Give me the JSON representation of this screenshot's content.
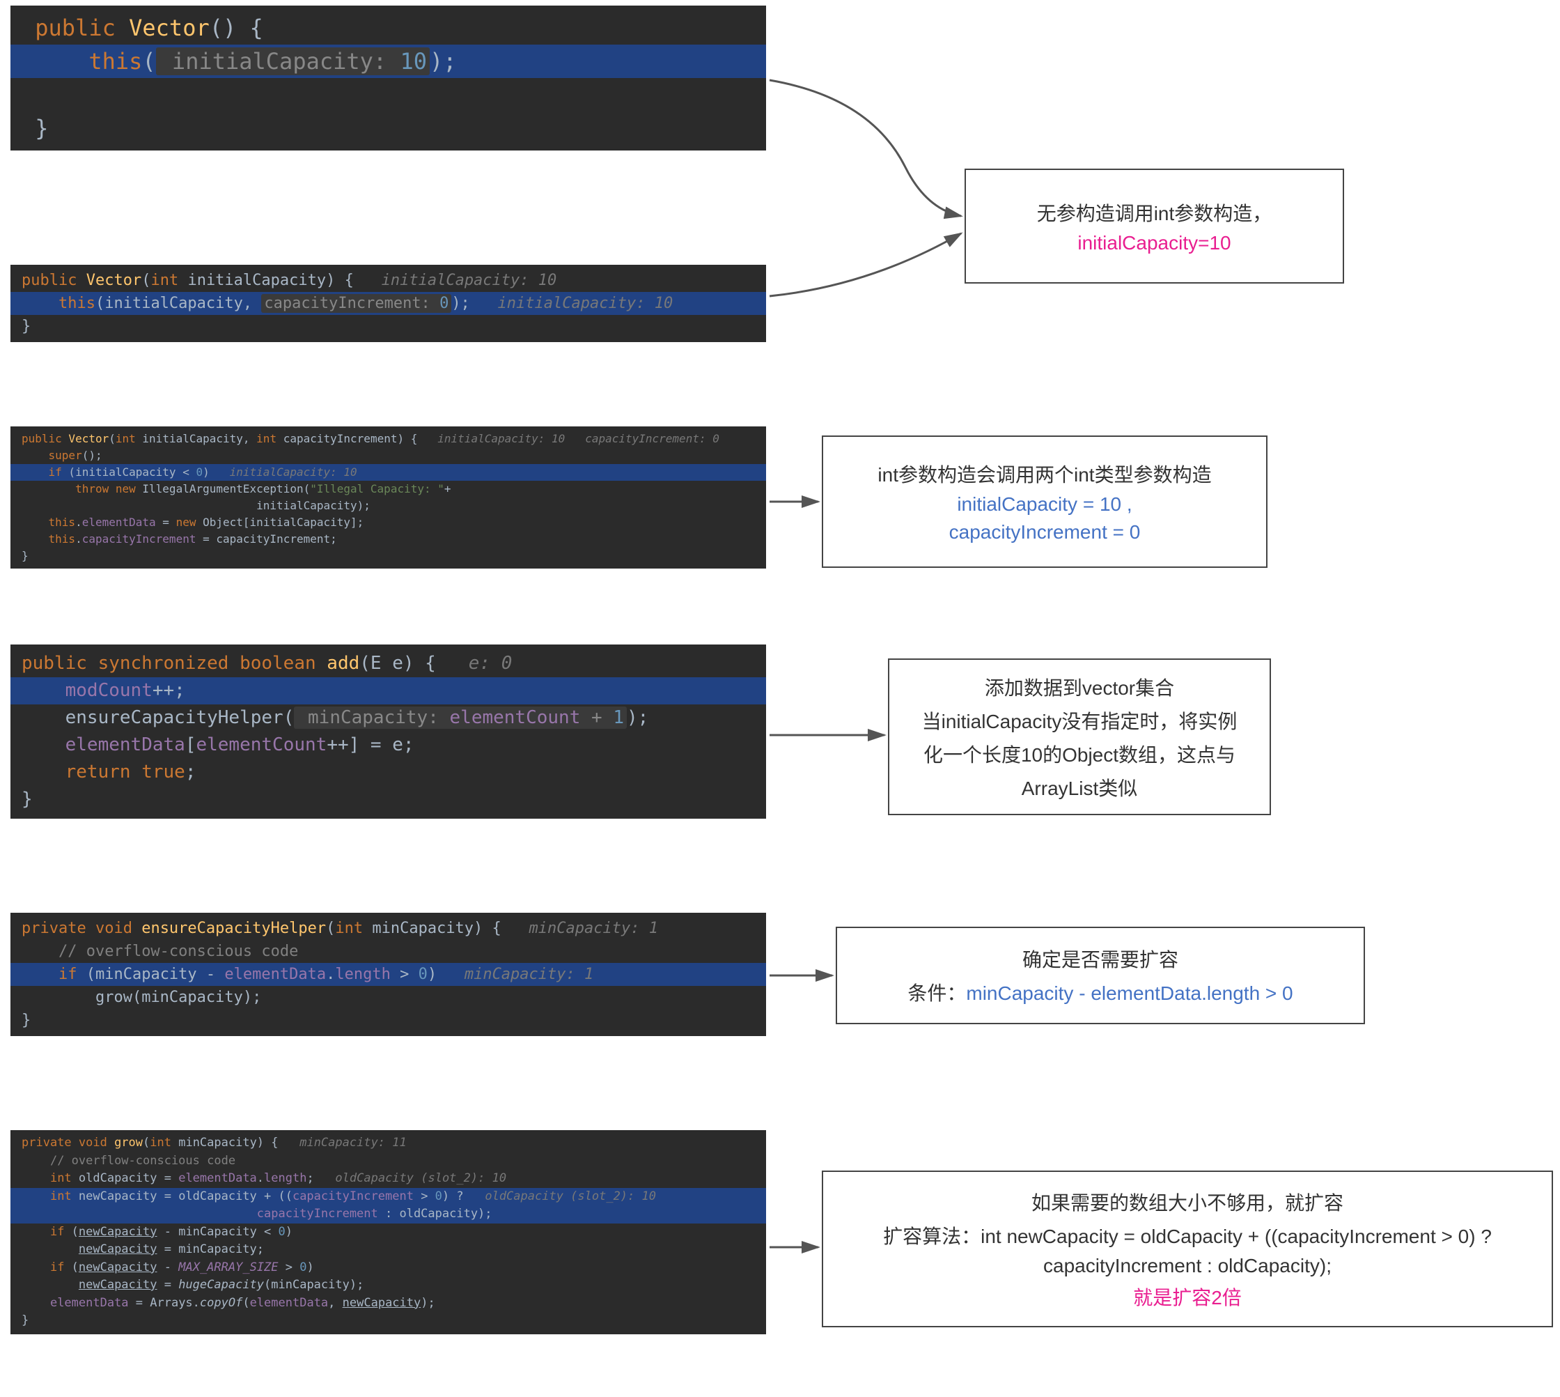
{
  "block1": {
    "line1_public": "public",
    "line1_method": " Vector",
    "line1_rest": "() {",
    "line2_this": "this",
    "line2_open": "(",
    "line2_hint": " initialCapacity: ",
    "line2_num": "10",
    "line2_close": ");",
    "line3": "}"
  },
  "block2": {
    "line1_public": "public",
    "line1_method": " Vector",
    "line1_params": "(",
    "line1_int": "int",
    "line1_param": " initialCapacity) {",
    "line1_hint": "   initialCapacity: 10",
    "line2_this": "this",
    "line2_open": "(initialCapacity, ",
    "line2_hint": "capacityIncrement: ",
    "line2_num": "0",
    "line2_close": ");",
    "line2_endhint": "   initialCapacity: 10",
    "line3": "}"
  },
  "block3": {
    "l1_public": "public",
    "l1_method": " Vector",
    "l1_open": "(",
    "l1_int1": "int",
    "l1_p1": " initialCapacity, ",
    "l1_int2": "int",
    "l1_p2": " capacityIncrement) {",
    "l1_hint": "   initialCapacity: 10   capacityIncrement: 0",
    "l2_super": "super",
    "l2_rest": "();",
    "l3_if": "if",
    "l3_cond": " (initialCapacity < ",
    "l3_num": "0",
    "l3_close": ")",
    "l3_hint": "   initialCapacity: 10",
    "l4_throw": "throw new",
    "l4_exc": " IllegalArgumentException(",
    "l4_str": "\"Illegal Capacity: \"",
    "l4_plus": "+",
    "l5_spc": "                                   initialCapacity);",
    "l6_this": "this",
    "l6_dot": ".",
    "l6_field": "elementData",
    "l6_eq": " = ",
    "l6_new": "new",
    "l6_rest": " Object[initialCapacity];",
    "l7_this": "this",
    "l7_dot": ".",
    "l7_field": "capacityIncrement",
    "l7_rest": " = capacityIncrement;",
    "l8": "}"
  },
  "block4": {
    "l1_public": "public synchronized boolean",
    "l1_method": " add",
    "l1_params": "(E e) {",
    "l1_hint": "   e: 0",
    "l2_field": "modCount",
    "l2_rest": "++;",
    "l3_method": "ensureCapacityHelper(",
    "l3_hint": " minCapacity: ",
    "l3_field": "elementCount",
    "l3_rest": " + ",
    "l3_num": "1",
    "l3_close": ");",
    "l4_field1": "elementData",
    "l4_open": "[",
    "l4_field2": "elementCount",
    "l4_rest": "++] = e;",
    "l5_return": "return true",
    "l5_semi": ";",
    "l6": "}"
  },
  "block5": {
    "l1_private": "private void",
    "l1_method": " ensureCapacityHelper",
    "l1_open": "(",
    "l1_int": "int",
    "l1_param": " minCapacity) {",
    "l1_hint": "   minCapacity: 1",
    "l2_comment": "// overflow-conscious code",
    "l3_if": "if",
    "l3_open": " (minCapacity - ",
    "l3_field": "elementData",
    "l3_dot": ".",
    "l3_len": "length",
    "l3_rest": " > ",
    "l3_num": "0",
    "l3_close": ")",
    "l3_hint": "   minCapacity: 1",
    "l4_call": "grow(minCapacity);",
    "l5": "}"
  },
  "block6": {
    "l1_private": "private void",
    "l1_method": " grow",
    "l1_open": "(",
    "l1_int": "int",
    "l1_param": " minCapacity) {",
    "l1_hint": "   minCapacity: 11",
    "l2_comment": "// overflow-conscious code",
    "l3_int": "int",
    "l3_var": " oldCapacity = ",
    "l3_field": "elementData",
    "l3_rest": ".",
    "l3_len": "length",
    "l3_semi": ";",
    "l3_hint": "   oldCapacity (slot_2): 10",
    "l4_int": "int",
    "l4_var": " newCapacity = oldCapacity + ((",
    "l4_field": "capacityIncrement",
    "l4_gt": " > ",
    "l4_num": "0",
    "l4_q": ") ?",
    "l4_hint": "   oldCapacity (slot_2): 10",
    "l5_spc": "                                 ",
    "l5_field": "capacityIncrement",
    "l5_rest": " : oldCapacity);",
    "l6_if": "if",
    "l6_cond": " (",
    "l6_u": "newCapacity",
    "l6_rest": " - minCapacity < ",
    "l6_num": "0",
    "l6_close": ")",
    "l7_u": "newCapacity",
    "l7_rest": " = minCapacity;",
    "l8_if": "if",
    "l8_cond": " (",
    "l8_u": "newCapacity",
    "l8_rest": " - ",
    "l8_const": "MAX_ARRAY_SIZE",
    "l8_gt": " > ",
    "l8_num": "0",
    "l8_close": ")",
    "l9_u": "newCapacity",
    "l9_eq": " = ",
    "l9_method": "hugeCapacity",
    "l9_rest": "(minCapacity);",
    "l10_field": "elementData",
    "l10_eq": " = Arrays.",
    "l10_method": "copyOf",
    "l10_open": "(",
    "l10_field2": "elementData",
    "l10_rest": ", ",
    "l10_u": "newCapacity",
    "l10_close": ");",
    "l11": "}"
  },
  "box1": {
    "l1": "无参构造调用int参数构造，",
    "l2": "initialCapacity=10"
  },
  "box2": {
    "l1": "int参数构造会调用两个int类型参数构造",
    "l2": "initialCapacity = 10 ,",
    "l3": "capacityIncrement = 0"
  },
  "box3": {
    "l1": "添加数据到vector集合",
    "l2": "当initialCapacity没有指定时，将实例",
    "l3": "化一个长度10的Object数组，这点与",
    "l4": "ArrayList类似"
  },
  "box4": {
    "l1": "确定是否需要扩容",
    "l2a": "条件：",
    "l2b": "minCapacity - elementData.length > 0"
  },
  "box5": {
    "l1": "如果需要的数组大小不够用，就扩容",
    "l2": "扩容算法：int newCapacity = oldCapacity + ((capacityIncrement > 0) ?",
    "l3": "capacityIncrement : oldCapacity);",
    "l4": "就是扩容2倍"
  }
}
